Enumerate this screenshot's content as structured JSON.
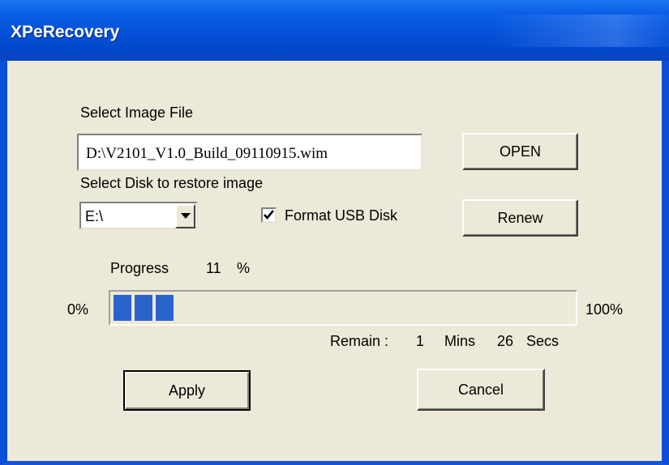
{
  "window": {
    "title": "XPeRecovery"
  },
  "image_file": {
    "label": "Select Image File",
    "path": "D:\\V2101_V1.0_Build_09110915.wim",
    "open_label": "OPEN"
  },
  "disk": {
    "label": "Select Disk to restore image",
    "selected": "E:\\",
    "format_label": "Format USB Disk",
    "format_checked": true,
    "renew_label": "Renew"
  },
  "progress": {
    "label": "Progress",
    "value": "11",
    "percent_sign": "%",
    "fraction": 0.11,
    "min_label": "0%",
    "max_label": "100%"
  },
  "remain": {
    "label": "Remain :",
    "mins_value": "1",
    "mins_unit": "Mins",
    "secs_value": "26",
    "secs_unit": "Secs"
  },
  "buttons": {
    "apply": "Apply",
    "cancel": "Cancel"
  },
  "colors": {
    "titlebar": "#0552d9",
    "progress_fill": "#2a63cc",
    "dialog_bg": "#ece9d8"
  }
}
